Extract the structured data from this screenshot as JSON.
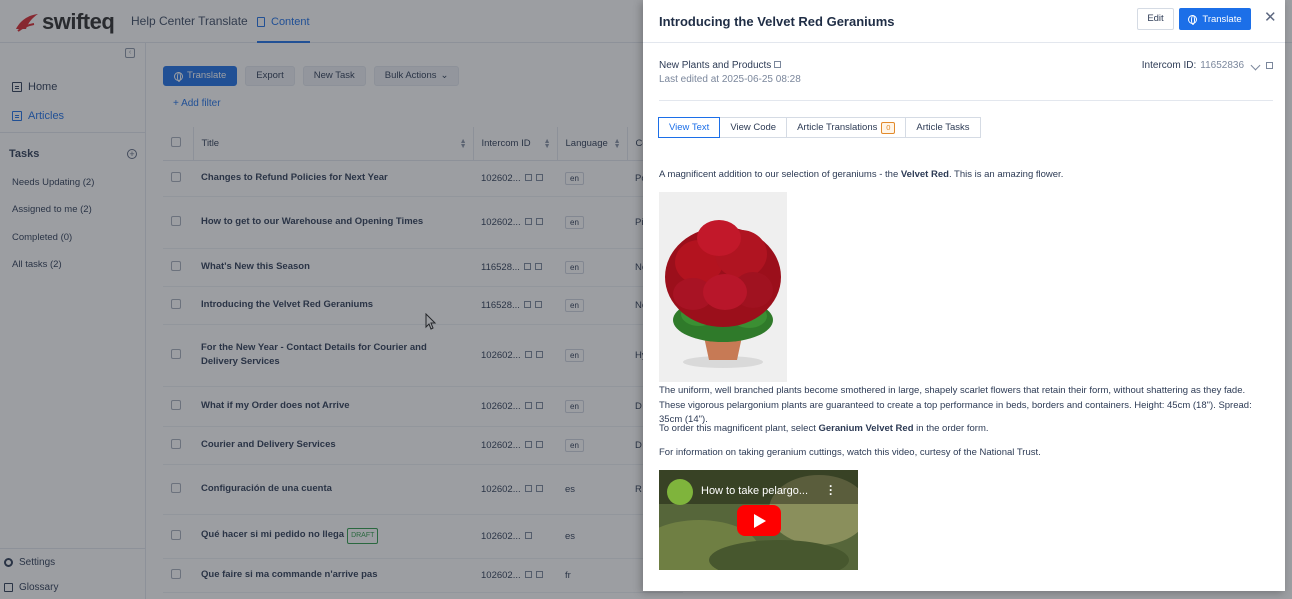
{
  "app": {
    "brand": "swifteq",
    "name": "Help Center Translate",
    "content_tab": "Content"
  },
  "sidebar": {
    "home": "Home",
    "articles": "Articles",
    "tasks_heading": "Tasks",
    "tasks": [
      "Needs Updating (2)",
      "Assigned to me (2)",
      "Completed (0)",
      "All tasks (2)"
    ],
    "settings": "Settings",
    "glossary": "Glossary"
  },
  "toolbar": {
    "translate": "Translate",
    "export": "Export",
    "new_task": "New Task",
    "bulk_actions": "Bulk Actions",
    "add_filter": "+ Add filter"
  },
  "table": {
    "headers": {
      "title": "Title",
      "intercom_id": "Intercom ID",
      "language": "Language",
      "collection": "Co"
    },
    "rows": [
      {
        "title": "Changes to Refund Policies for Next Year",
        "id": "102602...",
        "lang": "en",
        "col": "Po"
      },
      {
        "title": "How to get to our Warehouse and Opening Times",
        "id": "102602...",
        "lang": "en",
        "col": "Pi W"
      },
      {
        "title": "What's New this Season",
        "id": "116528...",
        "lang": "en",
        "col": "Ne"
      },
      {
        "title": "Introducing the Velvet Red Geraniums",
        "id": "116528...",
        "lang": "en",
        "col": "Ne"
      },
      {
        "title": "For the New Year - Contact Details for Courier and Delivery Services",
        "id": "102602...",
        "lang": "en",
        "col": "Hy C C"
      },
      {
        "title": "What if my Order does not Arrive",
        "id": "102602...",
        "lang": "en",
        "col": "D"
      },
      {
        "title": "Courier and Delivery Services",
        "id": "102602...",
        "lang": "en",
        "col": "D"
      },
      {
        "title": "Configuración de una cuenta",
        "id": "102602...",
        "lang": "es",
        "col": "R"
      },
      {
        "title": "Qué hacer si mi pedido no llega",
        "id": "102602...",
        "lang": "es",
        "col": "",
        "draft": "DRAFT"
      },
      {
        "title": "Que faire si ma commande n'arrive pas",
        "id": "102602...",
        "lang": "fr",
        "col": ""
      }
    ]
  },
  "drawer": {
    "title": "Introducing the Velvet Red Geraniums",
    "edit": "Edit",
    "translate": "Translate",
    "collection": "New Plants and Products",
    "last_edited": "Last edited at 2025-06-25 08:28",
    "intercom_label": "Intercom ID:",
    "intercom_value": "11652836",
    "tabs": {
      "view_text": "View Text",
      "view_code": "View Code",
      "article_translations": "Article Translations",
      "translations_count": "0",
      "article_tasks": "Article Tasks"
    },
    "p1_before": "A magnificent addition to our selection of geraniums - the ",
    "p1_bold": "Velvet Red",
    "p1_after": ". This is an amazing flower.",
    "p2": "The uniform, well branched plants become smothered in large, shapely scarlet flowers that retain their form, without shattering as they fade. These vigorous pelargonium plants are guaranteed to create a top performance in beds, borders and containers. Height: 45cm (18\"). Spread: 35cm (14\").",
    "p3_before": "To order this magnificent plant, select ",
    "p3_bold": "Geranium Velvet Red",
    "p3_after": " in the order form.",
    "p4": "For information on taking geranium cuttings, watch this video, curtesy of the National Trust.",
    "video_title": "How to take pelargo..."
  },
  "colors": {
    "accent": "#1c6fe8",
    "draft": "#2e9c49",
    "badge": "#e28a2b"
  }
}
